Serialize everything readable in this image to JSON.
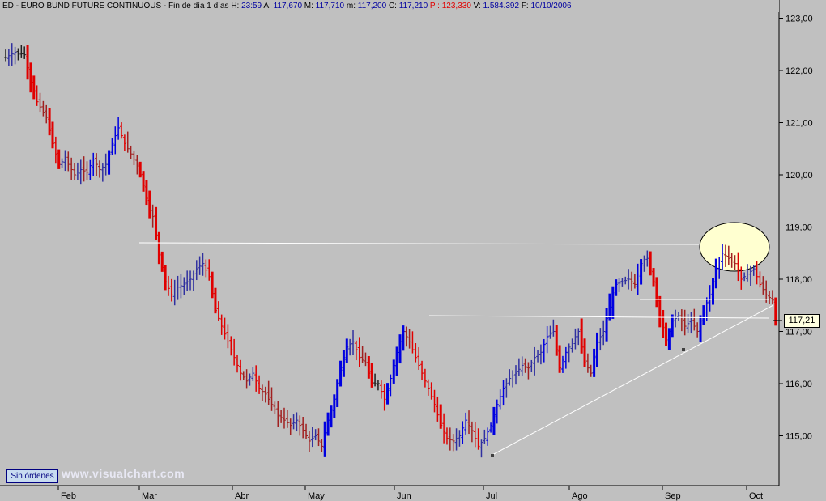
{
  "header": {
    "code": "ED",
    "instrument": "EURO BUND FUTURE CONTINUOUS",
    "period": "Fin de día 1 días",
    "h_label": "H:",
    "h_value": "23:59",
    "a_label": "A:",
    "a_value": "117,670",
    "m_label": "M:",
    "m_value": "117,710",
    "n_label": "m:",
    "n_value": "117,200",
    "c_label": "C:",
    "c_value": "117,210",
    "p_label": "P :",
    "p_value": "123,330",
    "v_label": "V:",
    "v_value": "1.584.392",
    "f_label": "F:",
    "f_value": "10/10/2006"
  },
  "orders_button": "Sin órdenes",
  "watermark": "www.visualchart.com",
  "last_price_label": "117,21",
  "colors": {
    "background": "#c0c0c0",
    "up": "#0000e0",
    "down": "#e00000",
    "neutral": "#202020",
    "trendline": "#ffffff"
  },
  "chart_data": {
    "type": "ohlc-bar",
    "y_ticks": [
      "123,00",
      "122,00",
      "121,00",
      "120,00",
      "119,00",
      "118,00",
      "117,00",
      "116,00",
      "115,00"
    ],
    "ylim": [
      114.2,
      123.2
    ],
    "x_ticks": [
      "Feb",
      "Mar",
      "Abr",
      "May",
      "Jun",
      "Jul",
      "Ago",
      "Sep",
      "Oct"
    ],
    "last_price": 117.21,
    "close_path": [
      [
        0,
        122.25
      ],
      [
        3,
        122.35
      ],
      [
        6,
        122.3
      ],
      [
        8,
        121.8
      ],
      [
        10,
        121.4
      ],
      [
        13,
        121.1
      ],
      [
        15,
        120.6
      ],
      [
        17,
        120.2
      ],
      [
        19,
        120.3
      ],
      [
        22,
        120.0
      ],
      [
        24,
        120.1
      ],
      [
        26,
        120.05
      ],
      [
        28,
        120.3
      ],
      [
        30,
        120.1
      ],
      [
        32,
        120.2
      ],
      [
        34,
        120.6
      ],
      [
        36,
        120.9
      ],
      [
        38,
        120.6
      ],
      [
        40,
        120.4
      ],
      [
        42,
        120.2
      ],
      [
        44,
        119.8
      ],
      [
        46,
        119.3
      ],
      [
        47,
        119.2
      ],
      [
        49,
        118.5
      ],
      [
        51,
        117.95
      ],
      [
        53,
        117.7
      ],
      [
        55,
        117.85
      ],
      [
        57,
        117.9
      ],
      [
        59,
        118.0
      ],
      [
        61,
        118.2
      ],
      [
        63,
        118.3
      ],
      [
        65,
        118.05
      ],
      [
        67,
        117.4
      ],
      [
        69,
        117.1
      ],
      [
        71,
        116.8
      ],
      [
        73,
        116.5
      ],
      [
        75,
        116.2
      ],
      [
        77,
        116.05
      ],
      [
        79,
        116.2
      ],
      [
        81,
        115.9
      ],
      [
        83,
        115.8
      ],
      [
        85,
        115.6
      ],
      [
        87,
        115.4
      ],
      [
        89,
        115.3
      ],
      [
        91,
        115.2
      ],
      [
        93,
        115.3
      ],
      [
        95,
        115.1
      ],
      [
        97,
        114.9
      ],
      [
        99,
        115.0
      ],
      [
        101,
        114.8
      ],
      [
        103,
        115.3
      ],
      [
        105,
        115.7
      ],
      [
        107,
        116.3
      ],
      [
        109,
        116.7
      ],
      [
        111,
        116.8
      ],
      [
        113,
        116.5
      ],
      [
        115,
        116.4
      ],
      [
        117,
        116.0
      ],
      [
        119,
        116.0
      ],
      [
        121,
        115.7
      ],
      [
        123,
        116.1
      ],
      [
        125,
        116.6
      ],
      [
        127,
        117.0
      ],
      [
        129,
        116.8
      ],
      [
        131,
        116.5
      ],
      [
        133,
        116.2
      ],
      [
        135,
        115.9
      ],
      [
        137,
        115.6
      ],
      [
        139,
        115.2
      ],
      [
        141,
        114.95
      ],
      [
        143,
        114.9
      ],
      [
        145,
        115.0
      ],
      [
        147,
        115.3
      ],
      [
        149,
        115.1
      ],
      [
        151,
        114.8
      ],
      [
        153,
        114.95
      ],
      [
        155,
        115.2
      ],
      [
        157,
        115.6
      ],
      [
        159,
        115.9
      ],
      [
        161,
        116.1
      ],
      [
        163,
        116.2
      ],
      [
        165,
        116.35
      ],
      [
        167,
        116.3
      ],
      [
        169,
        116.5
      ],
      [
        171,
        116.6
      ],
      [
        173,
        116.9
      ],
      [
        175,
        117.0
      ],
      [
        177,
        116.3
      ],
      [
        179,
        116.6
      ],
      [
        181,
        116.8
      ],
      [
        183,
        117.0
      ],
      [
        185,
        116.4
      ],
      [
        187,
        116.2
      ],
      [
        189,
        116.8
      ],
      [
        191,
        117.0
      ],
      [
        193,
        117.5
      ],
      [
        195,
        117.9
      ],
      [
        197,
        117.95
      ],
      [
        199,
        118.0
      ],
      [
        201,
        117.9
      ],
      [
        203,
        118.3
      ],
      [
        205,
        118.4
      ],
      [
        207,
        117.95
      ],
      [
        209,
        117.3
      ],
      [
        211,
        116.8
      ],
      [
        213,
        117.2
      ],
      [
        215,
        117.3
      ],
      [
        217,
        117.1
      ],
      [
        219,
        117.2
      ],
      [
        221,
        117.0
      ],
      [
        223,
        117.4
      ],
      [
        225,
        117.7
      ],
      [
        227,
        118.2
      ],
      [
        229,
        118.5
      ],
      [
        231,
        118.4
      ],
      [
        233,
        118.3
      ],
      [
        235,
        118.0
      ],
      [
        237,
        118.1
      ],
      [
        239,
        118.2
      ],
      [
        241,
        117.9
      ],
      [
        243,
        117.7
      ],
      [
        245,
        117.6
      ],
      [
        246,
        117.21
      ]
    ]
  }
}
